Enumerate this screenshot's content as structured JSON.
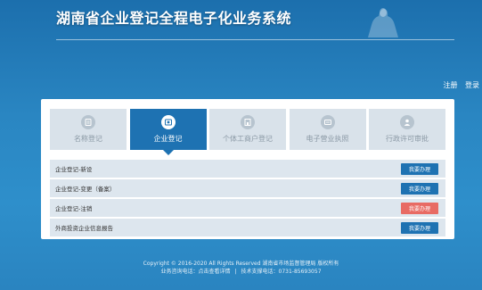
{
  "header": {
    "title": "湖南省企业登记全程电子化业务系统"
  },
  "auth": {
    "register": "注册",
    "login": "登录"
  },
  "tabs": [
    {
      "label": "名称登记",
      "icon": "name-register-icon",
      "active": false
    },
    {
      "label": "企业登记",
      "icon": "enterprise-register-icon",
      "active": true
    },
    {
      "label": "个体工商户登记",
      "icon": "individual-business-icon",
      "active": false
    },
    {
      "label": "电子营业执照",
      "icon": "e-license-icon",
      "active": false
    },
    {
      "label": "行政许可审批",
      "icon": "admin-approval-icon",
      "active": false
    }
  ],
  "rows": [
    {
      "label": "企业登记-新设",
      "button": "我要办理",
      "color": "#1e72b2"
    },
    {
      "label": "企业登记-变更（备案）",
      "button": "我要办理",
      "color": "#1e72b2"
    },
    {
      "label": "企业登记-注销",
      "button": "我要办理",
      "color": "#e86b64"
    },
    {
      "label": "外商投资企业信息报告",
      "button": "我要办理",
      "color": "#1e72b2"
    }
  ],
  "footer": {
    "copyright": "Copyright © 2016-2020 All Rights Reserved 湖南省市场监督管理局 版权所有",
    "consult": "业务咨询电话：点击查看详情",
    "support": "技术支撑电话：0731-85693057"
  },
  "colors": {
    "primary": "#1e72b2",
    "danger": "#e86b64",
    "background": "#2a86c2"
  }
}
